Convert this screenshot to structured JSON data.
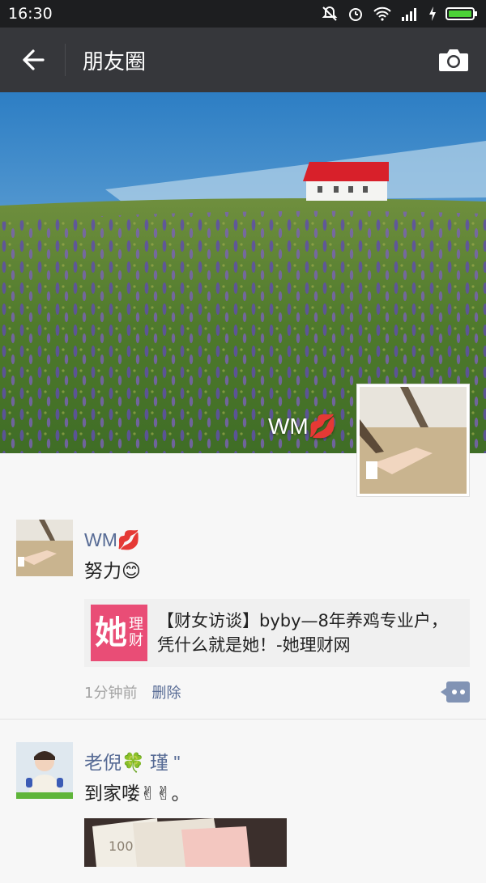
{
  "statusbar": {
    "time": "16:30"
  },
  "header": {
    "title": "朋友圈"
  },
  "cover": {
    "name": "WM💋"
  },
  "posts": [
    {
      "author": "WM💋",
      "text": "努力😊",
      "share": {
        "thumb_big": "她",
        "thumb_small_1": "理",
        "thumb_small_2": "财",
        "title_line1": "【财女访谈】byby—8年养鸡专业户，",
        "title_line2": "凭什么就是她！-她理财网"
      },
      "time": "1分钟前",
      "delete_label": "删除"
    },
    {
      "author": "老倪🍀 瑾 \"",
      "text": "到家喽✌✌。"
    }
  ],
  "colors": {
    "link": "#576b95",
    "topbar": "#36373b",
    "statusbar": "#1d1e20"
  }
}
